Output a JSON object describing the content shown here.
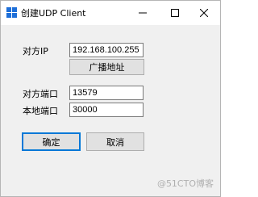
{
  "window": {
    "title": "创建UDP Client",
    "app_icon": "app-grid-icon",
    "controls": {
      "minimize_icon": "minimize-icon",
      "maximize_icon": "maximize-icon",
      "close_icon": "close-icon"
    }
  },
  "form": {
    "remote_ip_label": "对方IP",
    "remote_ip_value": "192.168.100.255",
    "broadcast_button": "广播地址",
    "remote_port_label": "对方端口",
    "remote_port_value": "13579",
    "local_port_label": "本地端口",
    "local_port_value": "30000"
  },
  "buttons": {
    "ok": "确定",
    "cancel": "取消"
  },
  "watermark": "@51CTO博客",
  "colors": {
    "focus_border": "#0078d7",
    "icon_blue": "#1e6fd9"
  }
}
